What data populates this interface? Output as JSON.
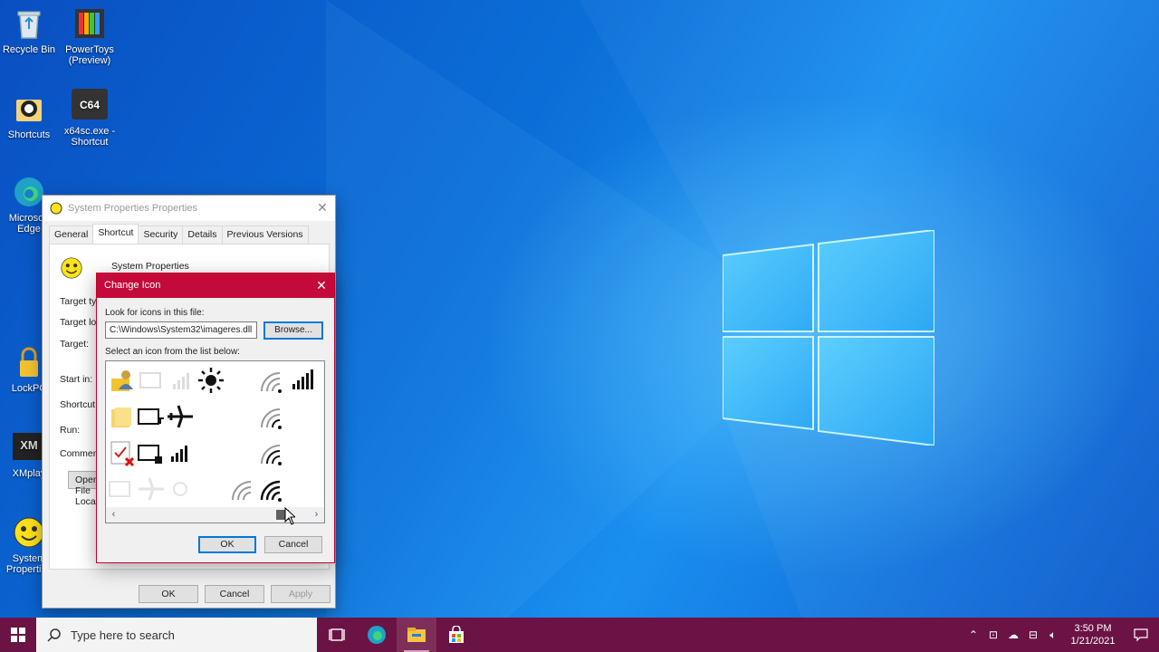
{
  "desktop": {
    "icons": [
      {
        "label": "Recycle Bin"
      },
      {
        "label": "PowerToys (Preview)"
      },
      {
        "label": "Shortcuts"
      },
      {
        "label": "x64sc.exe - Shortcut",
        "badge": "C64"
      },
      {
        "label": "Microsoft Edge"
      },
      {
        "label": "LockPC"
      },
      {
        "label": "XMplay"
      },
      {
        "label": "System Properties"
      }
    ]
  },
  "properties_window": {
    "title": "System Properties Properties",
    "tabs": [
      "General",
      "Shortcut",
      "Security",
      "Details",
      "Previous Versions"
    ],
    "active_tab": "Shortcut",
    "shortcut_name": "System Properties",
    "labels": {
      "target_type": "Target type:",
      "target_location": "Target location:",
      "target": "Target:",
      "start_in": "Start in:",
      "shortcut_key": "Shortcut key:",
      "run": "Run:",
      "comment": "Comment:"
    },
    "open_button": "Open File Location",
    "ok": "OK",
    "cancel": "Cancel",
    "apply": "Apply"
  },
  "change_icon_dialog": {
    "title": "Change Icon",
    "look_label": "Look for icons in this file:",
    "path_value": "C:\\Windows\\System32\\imageres.dll",
    "browse": "Browse...",
    "select_label": "Select an icon from the list below:",
    "icons": [
      "user-folder-icon",
      "monitor-faded-icon",
      "signal-faded-icon",
      "brightness-icon",
      "wifi-icon",
      "signal-bars-icon",
      "folder-icon",
      "monitor-arrow-icon",
      "airplane-icon",
      "wifi-icon",
      "checklist-error-icon",
      "monitor-lock-icon",
      "signal-bars-icon",
      "wifi-icon",
      "monitor-faded-icon",
      "airplane-faded-icon",
      "sun-faded-icon",
      "wifi-icon",
      "wifi-icon"
    ],
    "ok": "OK",
    "cancel": "Cancel"
  },
  "taskbar": {
    "search_placeholder": "Type here to search",
    "time": "3:50 PM",
    "date": "1/21/2021",
    "accent": "#6b1344"
  }
}
